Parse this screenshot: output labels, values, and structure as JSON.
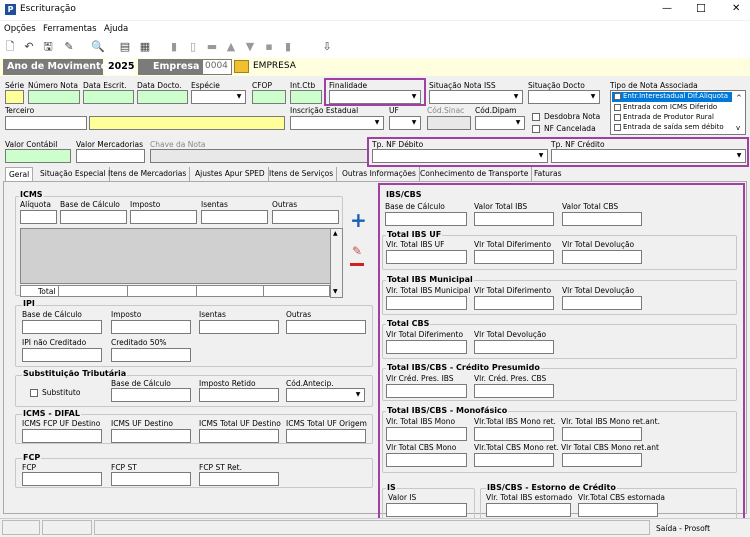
{
  "window": {
    "title": "Escrituração",
    "min": "—",
    "max": "☐",
    "close": "✕"
  },
  "menu": [
    "Opções",
    "Ferramentas",
    "Ajuda"
  ],
  "toolbar": [
    "🗋",
    "↶",
    "🖫",
    "✎",
    "🔍",
    "▤",
    "▦",
    "▮",
    "▯",
    "▬",
    "▲",
    "▼",
    "▪",
    "▮",
    "⇩"
  ],
  "header": {
    "mov_label": "Ano de Movimento",
    "mov_value": "2025",
    "empresa_label": "Empresa",
    "empresa_code": "0004",
    "empresa_name": "EMPRESA"
  },
  "row1": {
    "serie": "Série",
    "numero": "Número Nota",
    "data_escrit": "Data Escrit.",
    "data_docto": "Data Docto.",
    "especie": "Espécie",
    "cfop": "CFOP",
    "int_ctb": "Int.Ctb",
    "finalidade": "Finalidade",
    "sit_iss": "Situação Nota ISS",
    "sit_docto": "Situação Docto",
    "tipo_nota": "Tipo de Nota Associada"
  },
  "tipo_nota_items": [
    "Entr.Interestadual Dif.Aliquota",
    "Entrada com ICMS Diferido",
    "Entrada de Produtor Rural",
    "Entrada de saída sem débito"
  ],
  "row2": {
    "terceiro": "Terceiro",
    "ie": "Inscrição Estadual",
    "uf": "UF",
    "cod_sinac": "Cód.Sinac",
    "cod_dipam": "Cód.Dipam",
    "desdobra": "Desdobra Nota",
    "nf_cancelada": "NF Cancelada"
  },
  "row3": {
    "valor_contabil": "Valor Contábil",
    "valor_merc": "Valor Mercadorias",
    "chave": "Chave da Nota",
    "tp_debito": "Tp. NF Débito",
    "tp_credito": "Tp. NF Crédito"
  },
  "tabs": [
    "Geral",
    "Situação Especial",
    "Itens de Mercadorias",
    "Ajustes Apur SPED",
    "Itens de Serviços",
    "Outras Informações",
    "Conhecimento de Transporte",
    "Faturas"
  ],
  "icms": {
    "title": "ICMS",
    "cols": [
      "Alíquota",
      "Base de Cálculo",
      "Imposto",
      "Isentas",
      "Outras"
    ],
    "total": "Total"
  },
  "ipi": {
    "title": "IPI",
    "cols": [
      "Base de Cálculo",
      "Imposto",
      "Isentas",
      "Outras"
    ],
    "nao_cred": "IPI não Creditado",
    "cred50": "Creditado 50%"
  },
  "st": {
    "title": "Substituição Tributária",
    "substituto": "Substituto",
    "base": "Base de Cálculo",
    "imposto": "Imposto Retido",
    "cod": "Cód.Antecip."
  },
  "difal": {
    "title": "ICMS - DIFAL",
    "cols": [
      "ICMS FCP UF Destino",
      "ICMS UF Destino",
      "ICMS Total UF Destino",
      "ICMS Total UF Origem"
    ]
  },
  "fcp": {
    "title": "FCP",
    "cols": [
      "FCP",
      "FCP ST",
      "FCP ST Ret."
    ]
  },
  "ibscbs": {
    "title": "IBS/CBS",
    "cols": [
      "Base de Cálculo",
      "Valor Total IBS",
      "Valor Total CBS"
    ]
  },
  "ibsuf": {
    "title": "Total IBS UF",
    "cols": [
      "Vlr. Total IBS UF",
      "Vlr Total Diferimento",
      "Vlr Total Devolução"
    ]
  },
  "ibsmun": {
    "title": "Total IBS Municipal",
    "cols": [
      "Vlr. Total IBS Municipal",
      "Vlr Total Diferimento",
      "Vlr Total Devolução"
    ]
  },
  "cbs": {
    "title": "Total CBS",
    "cols": [
      "Vlr Total Diferimento",
      "Vlr Total Devolução"
    ]
  },
  "presumido": {
    "title": "Total IBS/CBS - Crédito Presumido",
    "cols": [
      "Vlr Créd. Pres. IBS",
      "Vlr. Créd. Pres. CBS"
    ]
  },
  "mono": {
    "title": "Total IBS/CBS - Monofásico",
    "cols": [
      "Vlr. Total IBS Mono",
      "Vlr.Total IBS Mono ret.",
      "Vlr. Total IBS Mono ret.ant."
    ],
    "cols2": [
      "Vlr Total CBS Mono",
      "Vlr.Total CBS Mono ret.",
      "Vlr Total CBS Mono ret.ant"
    ]
  },
  "is": {
    "title": "IS",
    "col": "Valor IS"
  },
  "estorno": {
    "title": "IBS/CBS - Estorno de Crédito",
    "cols": [
      "Vlr. Total IBS estornado",
      "Vlr.Total CBS estornada"
    ]
  },
  "status": {
    "right": "Saída - Prosoft"
  },
  "colors": {
    "accent": "#a040a0",
    "header_bar": "#7b7b7b",
    "green": "#ccffcc",
    "yellow": "#ffff99",
    "select": "#0078d7"
  }
}
